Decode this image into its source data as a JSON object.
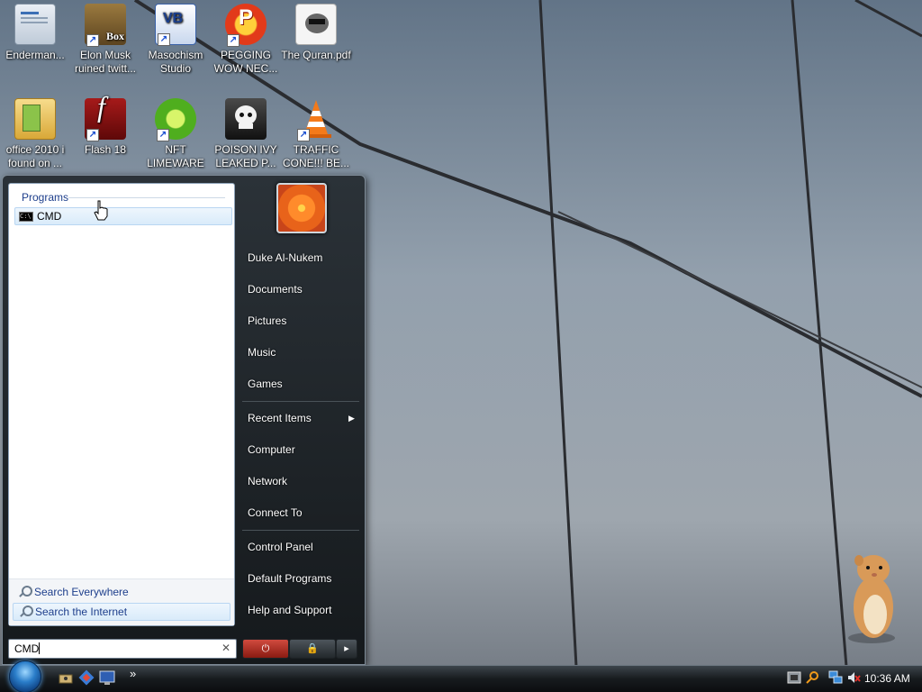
{
  "desktop_icons": [
    {
      "label": "Enderman...",
      "icon": "window-doc-icon"
    },
    {
      "label": "Elon Musk ruined twitt...",
      "icon": "boxed-game-icon",
      "badge": "Box"
    },
    {
      "label": "Masochism Studio",
      "icon": "vb-studio-icon",
      "badge": "VB"
    },
    {
      "label": "PEGGING WOW NEC...",
      "icon": "p-badge-icon",
      "badge": "P"
    },
    {
      "label": "The Quran.pdf",
      "icon": "raccoon-document-icon"
    },
    {
      "label": "office 2010 i found on ...",
      "icon": "folder-icon"
    },
    {
      "label": "Flash 18",
      "icon": "flash-icon",
      "badge": "f"
    },
    {
      "label": "NFT LIMEWARE",
      "icon": "limewire-icon"
    },
    {
      "label": "POISON IVY LEAKED P...",
      "icon": "skull-icon"
    },
    {
      "label": "TRAFFIC CONE!!! BE...",
      "icon": "traffic-cone-icon"
    }
  ],
  "start_menu": {
    "programs_header": "Programs",
    "results": [
      {
        "label": "CMD",
        "icon": "command-prompt-icon"
      }
    ],
    "search_options": [
      "Search Everywhere",
      "Search the Internet"
    ],
    "search_value": "CMD",
    "user_name": "Duke Al-Nukem",
    "right_items_top": [
      "Documents",
      "Pictures",
      "Music",
      "Games"
    ],
    "right_items_mid": [
      "Recent Items",
      "Computer",
      "Network",
      "Connect To"
    ],
    "right_items_bottom": [
      "Control Panel",
      "Default Programs",
      "Help and Support"
    ]
  },
  "taskbar": {
    "quick_launch_more": "»",
    "clock": "10:36 AM"
  },
  "colors": {
    "menu_dark": "#15191c",
    "accent_blue": "#1e3f8c",
    "selection": "#d9ebfa"
  }
}
